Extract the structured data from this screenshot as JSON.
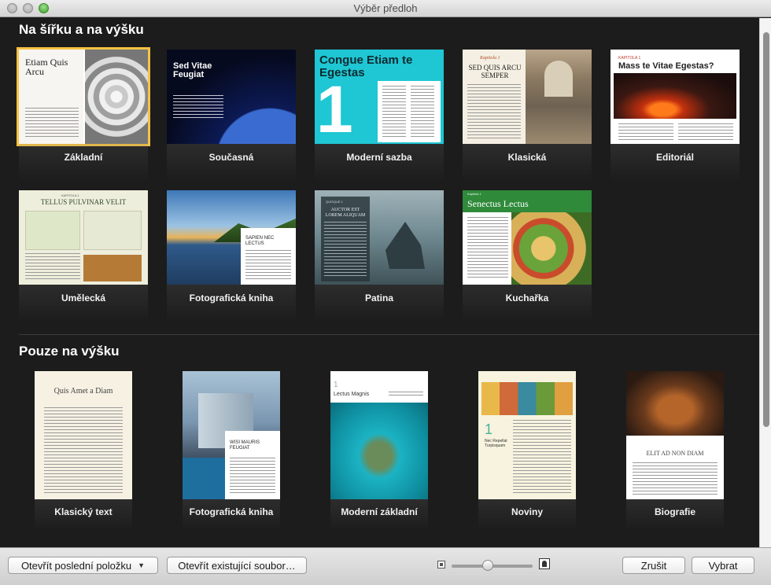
{
  "window": {
    "title": "Výběr předloh"
  },
  "sections": {
    "landscape": "Na šířku a na výšku",
    "portrait": "Pouze na výšku"
  },
  "landscape_templates": [
    {
      "label": "Základní",
      "selected": true,
      "thumb_title": "Etiam Quis Arcu"
    },
    {
      "label": "Současná",
      "thumb_title": "Sed Vitae Feugiat"
    },
    {
      "label": "Moderní sazba",
      "thumb_title": "Congue Etiam te Egestas",
      "thumb_number": "1"
    },
    {
      "label": "Klasická",
      "thumb_title": "SED QUIS ARCU SEMPER",
      "thumb_kicker": "Kapitola 1"
    },
    {
      "label": "Editoriál",
      "thumb_title": "Mass te Vitae Egestas?",
      "thumb_kicker": "KAPITOLA 1"
    }
  ],
  "landscape_templates_row2": [
    {
      "label": "Umělecká",
      "thumb_title": "TELLUS PULVINAR VELIT",
      "thumb_kicker": "KAPITOLA 1"
    },
    {
      "label": "Fotografická kniha",
      "thumb_title": "SAPIEN NEC LECTUS"
    },
    {
      "label": "Patina",
      "thumb_title": "AUCTOR EST LOREM ALIQUAM",
      "thumb_kicker": "QUISQUE 1"
    },
    {
      "label": "Kuchařka",
      "thumb_title": "Senectus Lectus",
      "thumb_kicker": "Kapitola 1"
    }
  ],
  "portrait_templates": [
    {
      "label": "Klasický text",
      "thumb_title": "Quis Amet a Diam"
    },
    {
      "label": "Fotografická kniha",
      "thumb_title": "WISI MAURIS FEUGIAT"
    },
    {
      "label": "Moderní základní",
      "thumb_title": "Lectus Magnis",
      "thumb_number": "1"
    },
    {
      "label": "Noviny",
      "thumb_title": "Nec Repellat Turpisquam",
      "thumb_number": "1"
    },
    {
      "label": "Biografie",
      "thumb_title": "ELIT AD NON DIAM"
    }
  ],
  "bottom": {
    "open_recent": "Otevřít poslední položku",
    "open_existing": "Otevřít existující soubor…",
    "cancel": "Zrušit",
    "choose": "Vybrat",
    "zoom_level": 0.45
  },
  "colors": {
    "selection": "#f6c343",
    "content_bg": "#1c1c1c",
    "modern_cyan": "#1fc6d3",
    "cookbook_green": "#2f8a3a"
  }
}
